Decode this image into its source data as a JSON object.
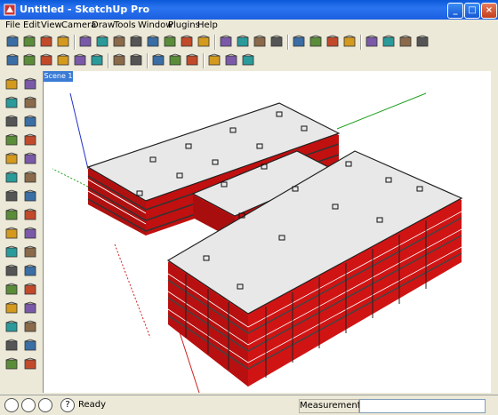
{
  "window": {
    "title": "Untitled - SketchUp Pro"
  },
  "title_buttons": {
    "minimize": "_",
    "maximize": "□",
    "close": "×"
  },
  "menu": [
    "File",
    "Edit",
    "View",
    "Camera",
    "Draw",
    "Tools",
    "Window",
    "Plugins",
    "Help"
  ],
  "scene_tab": "Scene 1",
  "status": {
    "text": "Ready",
    "measurements_label": "Measurements",
    "measurements_value": ""
  },
  "colors": {
    "title_bar": "#1b5fe0",
    "wall_red": "#e31b1b",
    "roof": "#e8e8e8",
    "axis_green": "#22a022",
    "axis_blue": "#2233cc",
    "axis_red": "#cc2222"
  },
  "icons": {
    "toolbar1": [
      "model-info-icon",
      "photo-textures-icon",
      "camera-icon",
      "add-location-icon",
      "component-icon",
      "component-options-icon",
      "model-house-icon",
      "add-plugin-icon",
      "grid-icon",
      "tool-wrench-icon",
      "wrench-icon",
      "battery-icon",
      "zoom-icon",
      "filter-icon",
      "cursor-icon",
      "warning-icon",
      "house-icon",
      "blue-house-icon",
      "green-house-icon",
      "color-bar-icon",
      "box-red-icon",
      "box-gray-icon",
      "box-teal-icon",
      "box-cube-icon"
    ],
    "toolbar2": [
      "iso-view-icon",
      "top-view-icon",
      "front-view-icon",
      "right-view-icon",
      "list-icon",
      "calendar-icon",
      "print-icon",
      "doc-icon",
      "stack-icon",
      "push-icon",
      "globe-icon",
      "layers-icon",
      "sandbox-icon",
      "eraser-icon"
    ],
    "left": [
      "select-icon",
      "eraser-icon",
      "paint-icon",
      "pencil-icon",
      "rectangle-icon",
      "line-icon",
      "circle-icon",
      "arc-icon",
      "polygon-icon",
      "freehand-icon",
      "move-icon",
      "pushpull-icon",
      "rotate-icon",
      "followme-icon",
      "scale-icon",
      "offset-icon",
      "tape-icon",
      "dimension-icon",
      "protractor-icon",
      "text-icon",
      "axes-icon",
      "3dtext-icon",
      "orbit-icon",
      "pan-icon",
      "zoom-icon",
      "zoomwindow-icon",
      "zoomext-icon",
      "prev-icon",
      "walk-icon",
      "lookaround-icon",
      "section-icon",
      "position-icon"
    ]
  }
}
